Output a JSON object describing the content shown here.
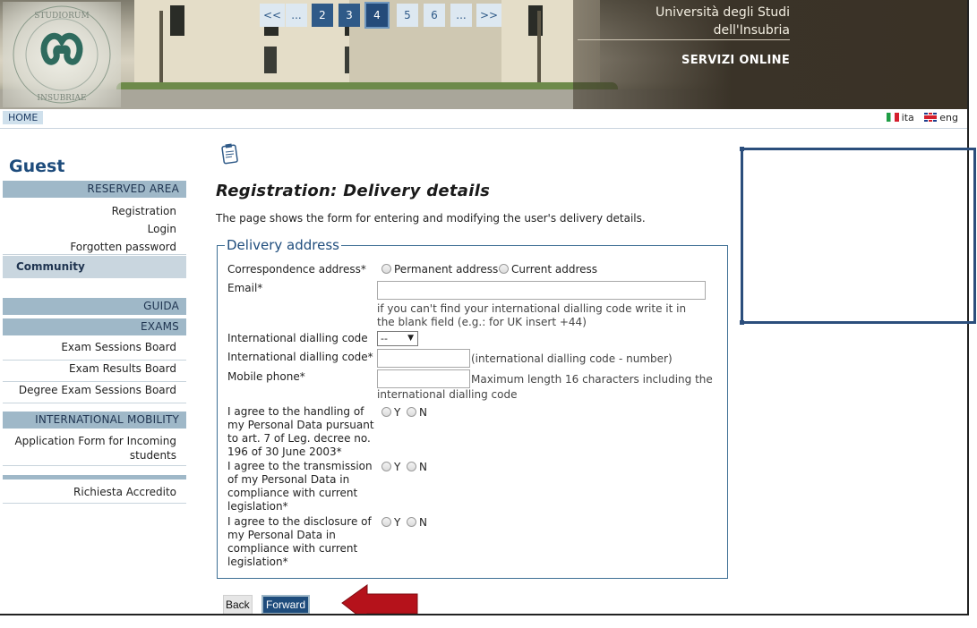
{
  "header": {
    "university_line1": "Università degli Studi",
    "university_line2": "dell'Insubria",
    "service": "SERVIZI ONLINE",
    "logo_motto": "UNIVERSITAS STUDIORUM INSUBRIAE"
  },
  "nav": {
    "home": "HOME",
    "languages": [
      {
        "code": "ita",
        "flag": "italy-flag-icon"
      },
      {
        "code": "eng",
        "flag": "uk-flag-icon"
      }
    ]
  },
  "sidebar": {
    "user": "Guest",
    "reserved_area": "RESERVED AREA",
    "registration": "Registration",
    "login": "Login",
    "forgotten_password": "Forgotten password",
    "community": "Community",
    "guida": "GUIDA",
    "exams": "EXAMS",
    "exam_sessions_board": "Exam Sessions Board",
    "exam_results_board": "Exam Results Board",
    "degree_exam_sessions_board": "Degree Exam Sessions Board",
    "international_mobility": "INTERNATIONAL MOBILITY",
    "application_form_line1": "Application Form for Incoming",
    "application_form_line2": "students",
    "richiesta_accredito": "Richiesta Accredito"
  },
  "pager": {
    "first": "<<",
    "ellipsis_left": "...",
    "pages": [
      "2",
      "3",
      "4",
      "5",
      "6"
    ],
    "current": "4",
    "ellipsis_right": "...",
    "last": ">>"
  },
  "main": {
    "title": "Registration: Delivery details",
    "description": "The page shows the form for entering and modifying the user's delivery details."
  },
  "form": {
    "legend": "Delivery address",
    "correspondence_label": "Correspondence address*",
    "permanent_address": "Permanent address",
    "current_address": "Current address",
    "email_label": "Email*",
    "email_value": "",
    "dialling_hint_line1": "if you can't find your international dialling code write it in",
    "dialling_hint_line2": "the blank field (e.g.: for UK insert +44)",
    "dialling_select_label": "International dialling code",
    "dialling_select_value": "--",
    "dialling_input_label": "International dialling code*",
    "dialling_input_value": "",
    "dialling_input_hint": "(international dialling code - number)",
    "mobile_label": "Mobile phone*",
    "mobile_value": "",
    "mobile_hint_line1": "Maximum length 16 characters including the",
    "mobile_hint_line2": "international dialling code",
    "consent1": [
      "I agree to the handling of",
      "my Personal Data pursuant",
      "to art. 7 of Leg. decree no.",
      "196 of 30 June 2003*"
    ],
    "consent2": [
      "I agree to the transmission",
      "of my Personal Data in",
      "compliance with current",
      "legislation*"
    ],
    "consent3": [
      "I agree to the disclosure of",
      "my Personal Data in",
      "compliance with current",
      "legislation*"
    ],
    "yes": "Y",
    "no": "N"
  },
  "buttons": {
    "back": "Back",
    "forward": "Forward"
  },
  "annotations": {
    "arrow_color": "#b5121b",
    "rect_color": "#2b4e7c"
  }
}
